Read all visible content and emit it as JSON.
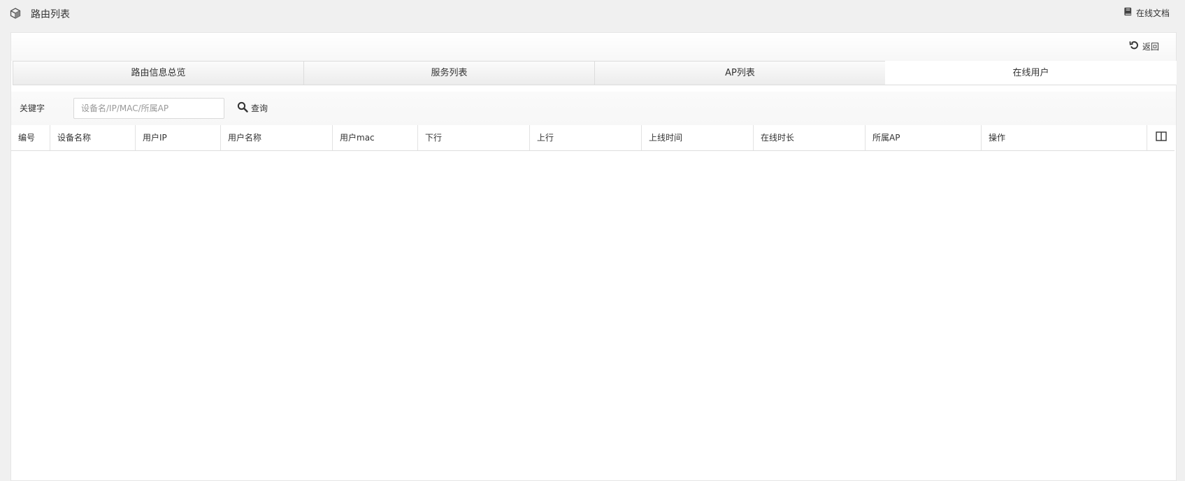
{
  "header": {
    "title": "路由列表",
    "title_icon": "cube-icon",
    "doc_link": "在线文档",
    "doc_icon": "book-icon"
  },
  "toolbar": {
    "back_label": "返回",
    "back_icon": "undo-icon"
  },
  "tabs": [
    {
      "label": "路由信息总览",
      "active": false
    },
    {
      "label": "服务列表",
      "active": false
    },
    {
      "label": "AP列表",
      "active": false
    },
    {
      "label": "在线用户",
      "active": true
    }
  ],
  "search": {
    "label": "关键字",
    "placeholder": "设备名/IP/MAC/所属AP",
    "value": "",
    "button_label": "查询",
    "button_icon": "search-icon"
  },
  "table": {
    "columns": [
      "编号",
      "设备名称",
      "用户IP",
      "用户名称",
      "用户mac",
      "下行",
      "上行",
      "上线时间",
      "在线时长",
      "所属AP",
      "操作"
    ],
    "column_toggle_icon": "columns-icon",
    "rows": []
  },
  "colors": {
    "background": "#f0f0f0",
    "panel": "#ffffff",
    "border": "#dcdcdc",
    "text": "#333333"
  }
}
